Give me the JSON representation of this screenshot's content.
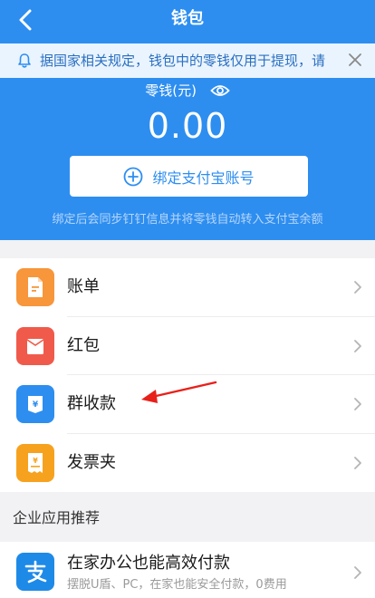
{
  "header": {
    "title": "钱包",
    "back_icon": "chevron-left-icon",
    "notice": {
      "text": "据国家相关规定，钱包中的零钱仅用于提现，请",
      "icon": "bell-icon",
      "close_icon": "close-icon"
    },
    "balance_label": "零钱(元)",
    "balance_value": "0.00",
    "bind_button_label": "绑定支付宝账号",
    "hint": "绑定后会同步钉钉信息并将零钱自动转入支付宝余额"
  },
  "menu": {
    "items": [
      {
        "label": "账单",
        "icon": "bill-icon"
      },
      {
        "label": "红包",
        "icon": "red-envelope-icon"
      },
      {
        "label": "群收款",
        "icon": "group-collect-icon"
      },
      {
        "label": "发票夹",
        "icon": "invoice-icon"
      }
    ]
  },
  "section": {
    "title": "企业应用推荐"
  },
  "promo": {
    "title": "在家办公也能高效付款",
    "subtitle": "摆脱U盾、PC，在家也能安全付款，0费用",
    "icon": "alipay-icon"
  },
  "colors": {
    "primary": "#2d8ef0",
    "bill": "#f7963a",
    "red_envelope": "#f05a4b",
    "group_collect": "#2d8ef0",
    "invoice": "#f7a21e",
    "annotation": "#e8201a"
  }
}
